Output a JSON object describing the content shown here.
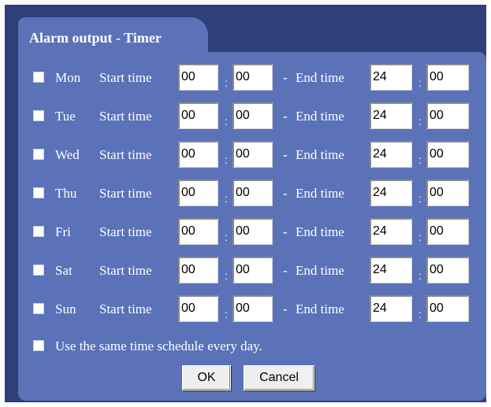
{
  "dialog": {
    "title": "Alarm output - Timer"
  },
  "labels": {
    "start": "Start time",
    "end": "End time",
    "colon": ":",
    "dash": "-"
  },
  "days": [
    {
      "name": "Mon",
      "checked": false,
      "start_h": "00",
      "start_m": "00",
      "end_h": "24",
      "end_m": "00"
    },
    {
      "name": "Tue",
      "checked": false,
      "start_h": "00",
      "start_m": "00",
      "end_h": "24",
      "end_m": "00"
    },
    {
      "name": "Wed",
      "checked": false,
      "start_h": "00",
      "start_m": "00",
      "end_h": "24",
      "end_m": "00"
    },
    {
      "name": "Thu",
      "checked": false,
      "start_h": "00",
      "start_m": "00",
      "end_h": "24",
      "end_m": "00"
    },
    {
      "name": "Fri",
      "checked": false,
      "start_h": "00",
      "start_m": "00",
      "end_h": "24",
      "end_m": "00"
    },
    {
      "name": "Sat",
      "checked": false,
      "start_h": "00",
      "start_m": "00",
      "end_h": "24",
      "end_m": "00"
    },
    {
      "name": "Sun",
      "checked": false,
      "start_h": "00",
      "start_m": "00",
      "end_h": "24",
      "end_m": "00"
    }
  ],
  "same_schedule": {
    "label": "Use the same time schedule every day.",
    "checked": false
  },
  "buttons": {
    "ok": "OK",
    "cancel": "Cancel"
  },
  "colors": {
    "panel": "#5b72b9",
    "frame": "#2e3f79",
    "text": "#ffffff"
  }
}
